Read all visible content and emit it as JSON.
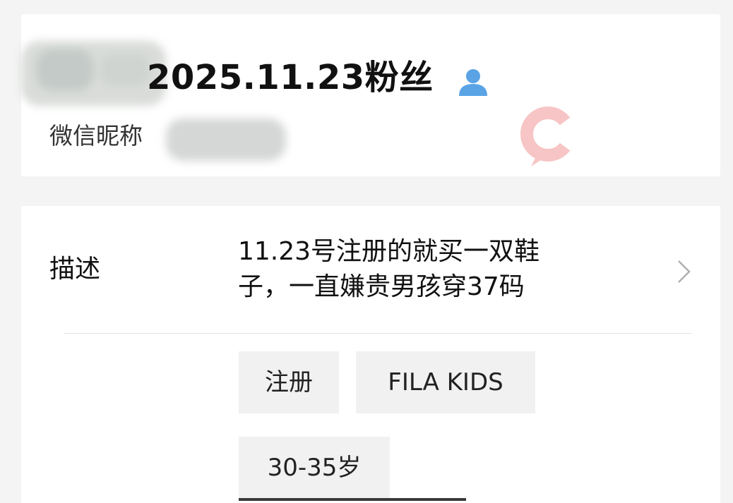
{
  "header": {
    "group_name": "2025.11.23粉丝",
    "nickname_label": "微信昵称"
  },
  "detail": {
    "label": "描述",
    "text_line1": "11.23号注册的就买一双鞋",
    "text_line2": "子，一直嫌贵男孩穿37码"
  },
  "tags": [
    {
      "label": "注册"
    },
    {
      "label": "FILA KIDS"
    },
    {
      "label": "30-35岁"
    }
  ],
  "icons": {
    "user": "user-icon",
    "chevron": "chevron-right-icon",
    "watermark": "watermark-logo-icon"
  },
  "colors": {
    "user_icon": "#5aa4e6",
    "tag_bg": "#f1f1f1",
    "page_bg": "#f4f4f4",
    "watermark": "#f08c8c"
  }
}
